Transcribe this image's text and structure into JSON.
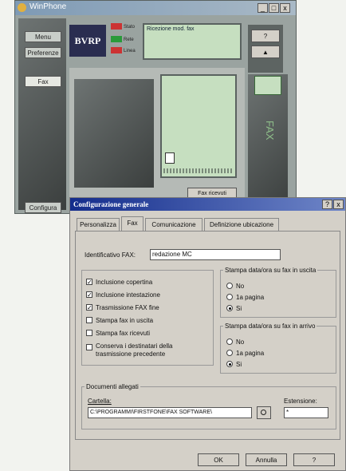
{
  "app": {
    "title": "WinPhone",
    "logo": "BVRP",
    "side_buttons": [
      "Menu",
      "Preferenze",
      "Fax",
      "Configura"
    ],
    "status_text": "Ricezione mod. fax",
    "mini_labels": [
      "Stato",
      "Rete",
      "Linea"
    ],
    "fax_received_label": "Fax ricevuti",
    "right_label": "FAX",
    "top_right_buttons": [
      "?",
      "▲"
    ],
    "window_controls": [
      "_",
      "□",
      "x"
    ]
  },
  "dialog": {
    "title": "Configurazione generale",
    "help_btn": "?",
    "close_btn": "x",
    "tabs": [
      "Personalizza",
      "Fax",
      "Comunicazione",
      "Definizione ubicazione"
    ],
    "selected_tab": "Fax",
    "fax_id_label": "Identificativo FAX:",
    "fax_id_value": "redazione MC",
    "checkboxes": [
      {
        "label": "Inclusione copertina",
        "checked": true
      },
      {
        "label": "Inclusione intestazione",
        "checked": true
      },
      {
        "label": "Trasmissione FAX fine",
        "checked": true
      },
      {
        "label": "Stampa fax in uscita",
        "checked": false
      },
      {
        "label": "Stampa fax ricevuti",
        "checked": false
      },
      {
        "label": "Conserva i destinatari della",
        "label2": "trasmissione precedente",
        "checked": false
      }
    ],
    "print_out": {
      "title": "Stampa data/ora su fax in uscita",
      "options": [
        "No",
        "1a pagina",
        "Si"
      ],
      "selected": "Si"
    },
    "print_in": {
      "title": "Stampa data/ora su fax in arrivo",
      "options": [
        "No",
        "1a pagina",
        "Si"
      ],
      "selected": "Si"
    },
    "attachments": {
      "title": "Documenti allegati",
      "folder_label": "Cartella:",
      "folder_value": "C:\\PROGRAMMI\\FIRSTFONE\\FAX SOFTWARE\\",
      "ext_label": "Estensione:",
      "ext_value": "*"
    },
    "buttons": {
      "ok": "OK",
      "cancel": "Annulla",
      "help": "?"
    }
  },
  "colors": {
    "dialog_title": "#142d8c",
    "app_body": "#9aa3a0",
    "screen_green": "#c6dfc0"
  }
}
